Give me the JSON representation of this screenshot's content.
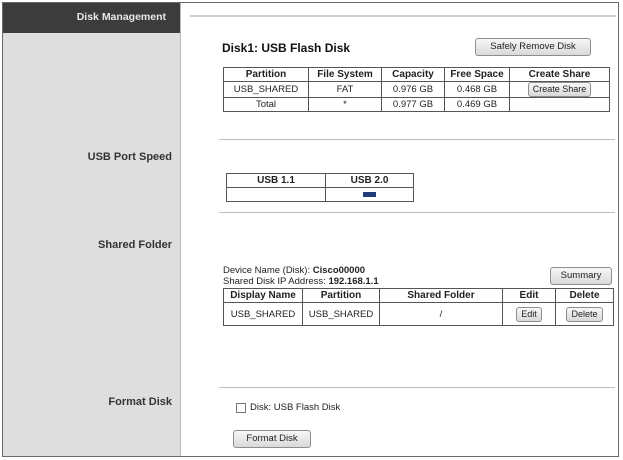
{
  "sidebar": {
    "header": "Disk Management",
    "labels": {
      "usb_port_speed": "USB Port Speed",
      "shared_folder": "Shared Folder",
      "format_disk": "Format Disk"
    }
  },
  "disk": {
    "title": "Disk1: USB Flash Disk",
    "safely_remove_label": "Safely Remove Disk",
    "table": {
      "headers": [
        "Partition",
        "File System",
        "Capacity",
        "Free Space",
        "Create Share"
      ],
      "rows": [
        {
          "partition": "USB_SHARED",
          "fs": "FAT",
          "capacity": "0.976 GB",
          "free": "0.468 GB",
          "action": "Create Share"
        },
        {
          "partition": "Total",
          "fs": "*",
          "capacity": "0.977 GB",
          "free": "0.469 GB",
          "action": ""
        }
      ]
    }
  },
  "usb_speed": {
    "headers": [
      "USB 1.1",
      "USB 2.0"
    ],
    "selected": "USB 2.0"
  },
  "shared_folder": {
    "device_name_label": "Device Name (Disk):",
    "device_name": "Cisco00000",
    "ip_label": "Shared Disk IP Address:",
    "ip": "192.168.1.1",
    "summary_label": "Summary",
    "table": {
      "headers": [
        "Display Name",
        "Partition",
        "Shared Folder",
        "Edit",
        "Delete"
      ],
      "rows": [
        {
          "display": "USB_SHARED",
          "partition": "USB_SHARED",
          "folder": "/",
          "edit": "Edit",
          "delete": "Delete"
        }
      ]
    }
  },
  "format": {
    "checkbox_label": "Disk: USB Flash Disk",
    "button_label": "Format Disk"
  }
}
